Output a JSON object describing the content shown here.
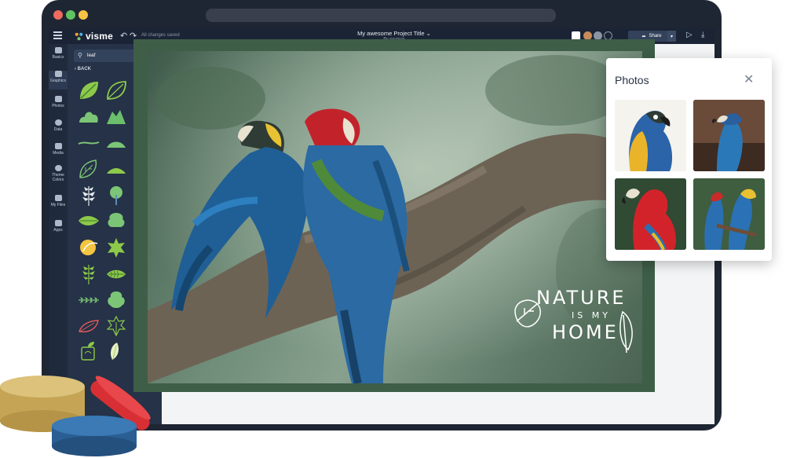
{
  "app": {
    "logo_text": "visme",
    "autosave_status": "All changes saved",
    "project_title": "My awesome Project Title",
    "project_byline": "By psymon",
    "share_label": "Share"
  },
  "rail": {
    "items": [
      {
        "label": "Basics",
        "icon": "basics-icon"
      },
      {
        "label": "Graphics",
        "icon": "graphics-icon"
      },
      {
        "label": "Photos",
        "icon": "photos-icon"
      },
      {
        "label": "Data",
        "icon": "data-icon"
      },
      {
        "label": "Media",
        "icon": "media-icon"
      },
      {
        "label": "Theme Colors",
        "icon": "palette-icon"
      },
      {
        "label": "My Files",
        "icon": "folder-icon"
      },
      {
        "label": "Apps",
        "icon": "apps-icon"
      }
    ]
  },
  "panel": {
    "search_value": "leaf",
    "back_label": "BACK"
  },
  "canvas": {
    "headline_1": "NATURE",
    "headline_2": "IS MY",
    "headline_3": "HOME"
  },
  "photos_panel": {
    "title": "Photos"
  },
  "colors": {
    "leaf_green": "#7cc576",
    "leaf_dark": "#5aa35a",
    "frame_green": "#3e5e48",
    "share_bg": "#33415a"
  }
}
